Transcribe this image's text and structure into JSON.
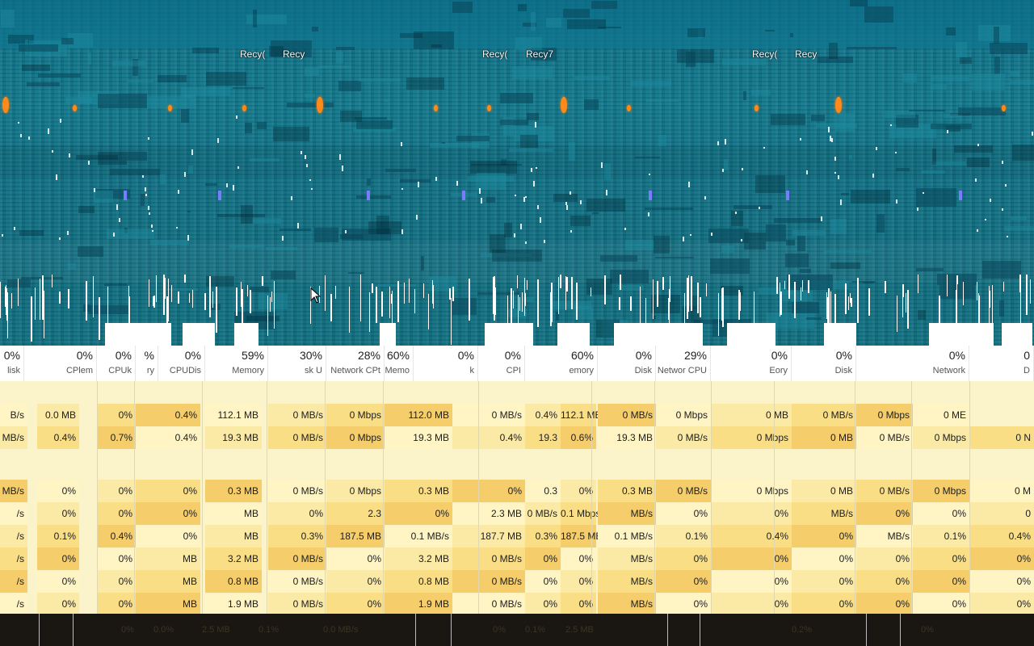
{
  "desktop": {
    "icons": [
      "Recy(",
      "Recy",
      "Recy(",
      "Recy7",
      "Recy(",
      "Recy"
    ]
  },
  "header": {
    "columns": [
      {
        "pct": "0%",
        "name": "lisk"
      },
      {
        "pct": "0%",
        "name": "CPlem"
      },
      {
        "pct": "0%",
        "name": "CPUk"
      },
      {
        "pct": "%",
        "name": "ry"
      },
      {
        "pct": "0%",
        "name": "CPUDis"
      },
      {
        "pct": "59%",
        "name": "Memory"
      },
      {
        "pct": "30%",
        "name": "sk U"
      },
      {
        "pct": "28%",
        "name": "Network CPt"
      },
      {
        "pct": "60%",
        "name": "Memo"
      },
      {
        "pct": "0%",
        "name": "k"
      },
      {
        "pct": "0%",
        "name": "CPI"
      },
      {
        "pct": "60%",
        "name": "emory"
      },
      {
        "pct": "0%",
        "name": "Disk"
      },
      {
        "pct": "29%",
        "name": "Networ CPU"
      },
      {
        "pct": "0%",
        "name": "Eory"
      },
      {
        "pct": "0%",
        "name": "Disk"
      },
      {
        "pct": "0%",
        "name": "Network"
      },
      {
        "pct": "0",
        "name": "D"
      }
    ]
  },
  "rows": [
    [
      "B/s",
      "0.0 MB",
      "0%",
      "0.4%",
      "112.1 MB",
      "0 MB/s",
      "0 Mbps",
      "112.0 MB",
      "0 MB/s",
      "0.4%",
      "112.1 MB",
      "0 MB/s",
      "0 Mbps",
      "0 MB",
      "0 MB/s",
      "0 Mbps",
      "0 ME"
    ],
    [
      "MB/s",
      "0.4%",
      "0.7%",
      "0.4%",
      "19.3 MB",
      "0 MB/s",
      "0 Mbps",
      "19.3 MB",
      "0.4%",
      "19.3",
      "0.6%",
      "19.3 MB",
      "0 MB/s",
      "0 Mbps",
      "0 MB",
      "0 MB/s",
      "0 Mbps",
      "0 N"
    ],
    [],
    [
      "MB/s",
      "0%",
      "0%",
      "0%",
      "0.3 MB",
      "0 MB/s",
      "0 Mbps",
      "0.3 MB",
      "0%",
      "0.3",
      "0%",
      "0.3 MB",
      "0 MB/s",
      "0 Mbps",
      "0 MB",
      "0 MB/s",
      "0 Mbps",
      "0 M"
    ],
    [
      "/s",
      "0%",
      "0%",
      "0%",
      "MB",
      "0%",
      "2.3",
      "0%",
      "2.3 MB",
      "0 MB/s",
      "0.1 Mbps",
      "MB/s",
      "0%",
      "0%",
      "MB/s",
      "0%",
      "0%",
      "0"
    ],
    [
      "/s",
      "0.1%",
      "0.4%",
      "0%",
      "MB",
      "0.3%",
      "187.5 MB",
      "0.1 MB/s",
      "187.7 MB",
      "0.3%",
      "187.5 MB",
      "0.1 MB/s",
      "0.1%",
      "0.4%",
      "0%",
      "MB/s",
      "0.1%",
      "0.4%"
    ],
    [
      "/s",
      "0%",
      "0%",
      "MB",
      "3.2 MB",
      "0 MB/s",
      "0%",
      "3.2 MB",
      "0 MB/s",
      "0%",
      "0%",
      "MB/s",
      "0%",
      "0%",
      "0%",
      "0%",
      "0%",
      "0%"
    ],
    [
      "/s",
      "0%",
      "0%",
      "MB",
      "0.8 MB",
      "0 MB/s",
      "0%",
      "0.8 MB",
      "0 MB/s",
      "0%",
      "0%",
      "MB/s",
      "0%",
      "0%",
      "0%",
      "0%",
      "0%",
      "0%"
    ],
    [
      "/s",
      "0%",
      "0%",
      "MB",
      "1.9 MB",
      "0 MB/s",
      "0%",
      "1.9 MB",
      "0 MB/s",
      "0%",
      "0%",
      "MB/s",
      "0%",
      "0%",
      "0%",
      "0%",
      "0%",
      "0%"
    ]
  ],
  "taskbar": {
    "ghost_text": [
      "0%",
      "0.0%",
      "2.5 MB",
      "0.1%",
      "0.0 MB/s",
      "0%",
      "0.1%",
      "2.5 MB",
      "0.2%",
      "0%"
    ]
  }
}
